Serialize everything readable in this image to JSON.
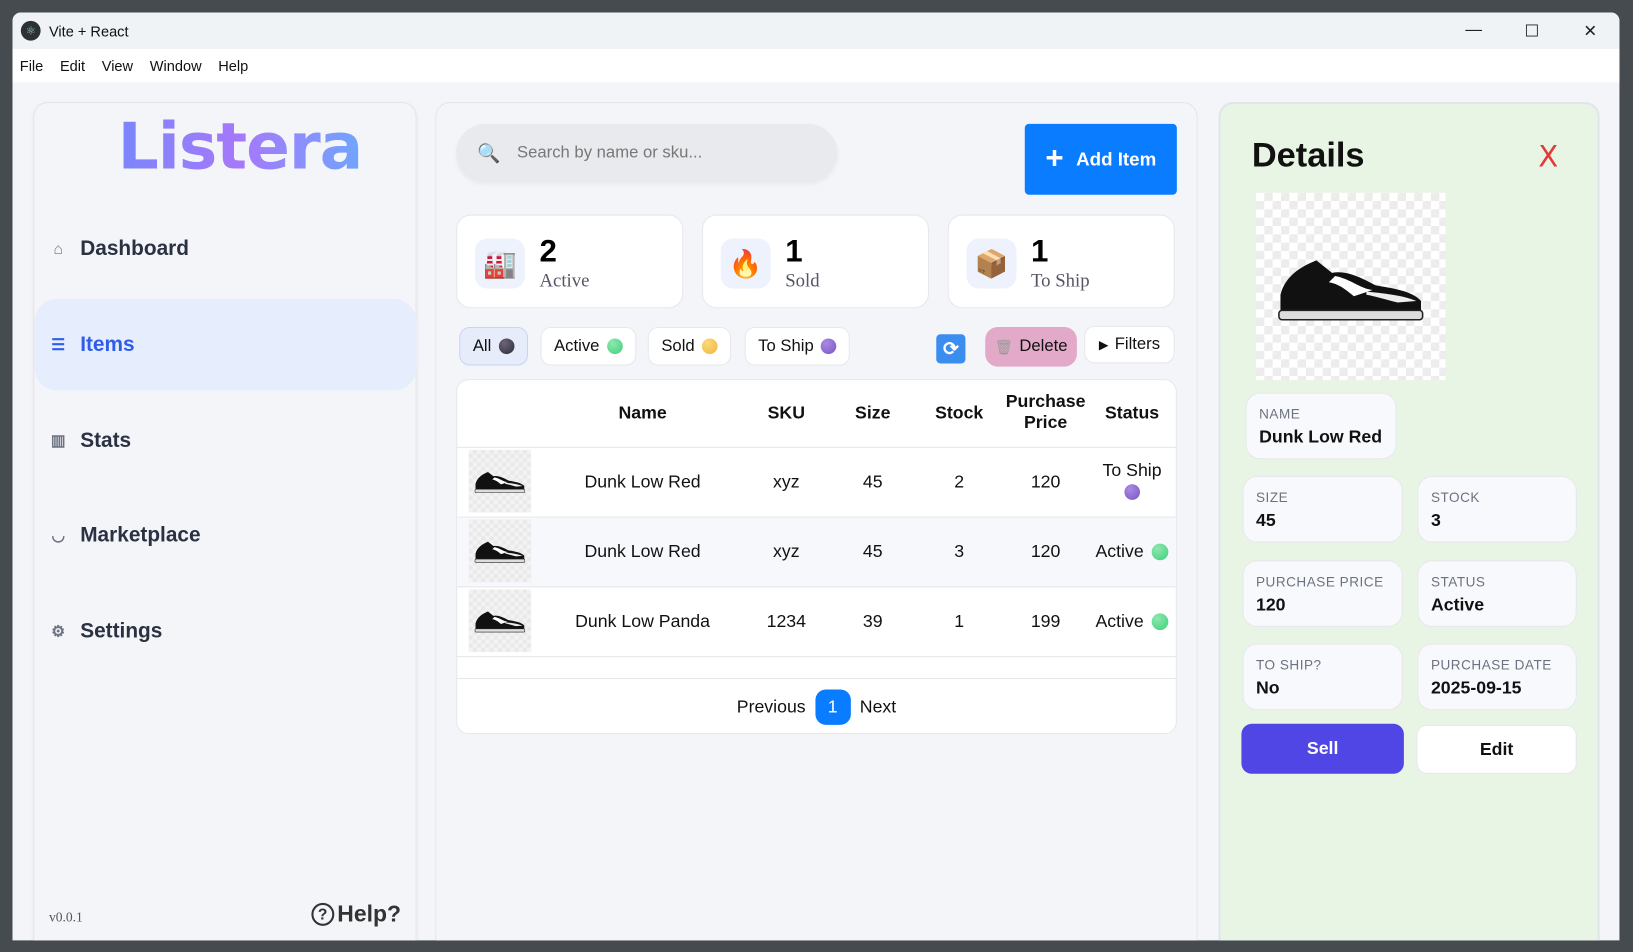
{
  "window": {
    "title": "Vite + React",
    "controls": [
      "—",
      "☐",
      "✕"
    ]
  },
  "menu": [
    "File",
    "Edit",
    "View",
    "Window",
    "Help"
  ],
  "sidebar": {
    "logo": "Listera",
    "items": [
      {
        "label": "Dashboard",
        "icon": "home-icon",
        "active": false
      },
      {
        "label": "Items",
        "icon": "list-icon",
        "active": true
      },
      {
        "label": "Stats",
        "icon": "bar-chart-icon",
        "active": false
      },
      {
        "label": "Marketplace",
        "icon": "basket-icon",
        "active": false
      },
      {
        "label": "Settings",
        "icon": "gear-icon",
        "active": false
      }
    ],
    "version": "v0.0.1",
    "help": "Help?"
  },
  "main": {
    "search_placeholder": "Search by name or sku...",
    "add_item": "Add Item",
    "stats": [
      {
        "value": "2",
        "label": "Active",
        "icon": "factory-icon"
      },
      {
        "value": "1",
        "label": "Sold",
        "icon": "fire-icon"
      },
      {
        "value": "1",
        "label": "To Ship",
        "icon": "package-icon"
      }
    ],
    "filters": [
      {
        "label": "All",
        "color": "#2f2b3a",
        "selected": true
      },
      {
        "label": "Active",
        "color": "#3ecf7a",
        "selected": false
      },
      {
        "label": "Sold",
        "color": "#f2b53a",
        "selected": false
      },
      {
        "label": "To Ship",
        "color": "#7a55c8",
        "selected": false
      }
    ],
    "delete": "Delete",
    "filters_button": "Filters",
    "table": {
      "headers": [
        "Name",
        "SKU",
        "Size",
        "Stock",
        "Purchase Price",
        "Status"
      ],
      "rows": [
        {
          "name": "Dunk Low Red",
          "sku": "xyz",
          "size": "45",
          "stock": "2",
          "price": "120",
          "status": "To Ship",
          "status_color": "#7a55c8"
        },
        {
          "name": "Dunk Low Red",
          "sku": "xyz",
          "size": "45",
          "stock": "3",
          "price": "120",
          "status": "Active",
          "status_color": "#3ecf7a"
        },
        {
          "name": "Dunk Low Panda",
          "sku": "1234",
          "size": "39",
          "stock": "1",
          "price": "199",
          "status": "Active",
          "status_color": "#3ecf7a"
        }
      ]
    },
    "pagination": {
      "previous": "Previous",
      "page": "1",
      "next": "Next"
    }
  },
  "details": {
    "title": "Details",
    "close": "X",
    "fields": {
      "name": {
        "label": "NAME",
        "value": "Dunk Low Red"
      },
      "size": {
        "label": "SIZE",
        "value": "45"
      },
      "stock": {
        "label": "STOCK",
        "value": "3"
      },
      "purchase_price": {
        "label": "PURCHASE PRICE",
        "value": "120"
      },
      "status": {
        "label": "STATUS",
        "value": "Active"
      },
      "to_ship": {
        "label": "TO SHIP?",
        "value": "No"
      },
      "purchase_date": {
        "label": "PURCHASE DATE",
        "value": "2025-09-15"
      }
    },
    "sell": "Sell",
    "edit": "Edit"
  }
}
